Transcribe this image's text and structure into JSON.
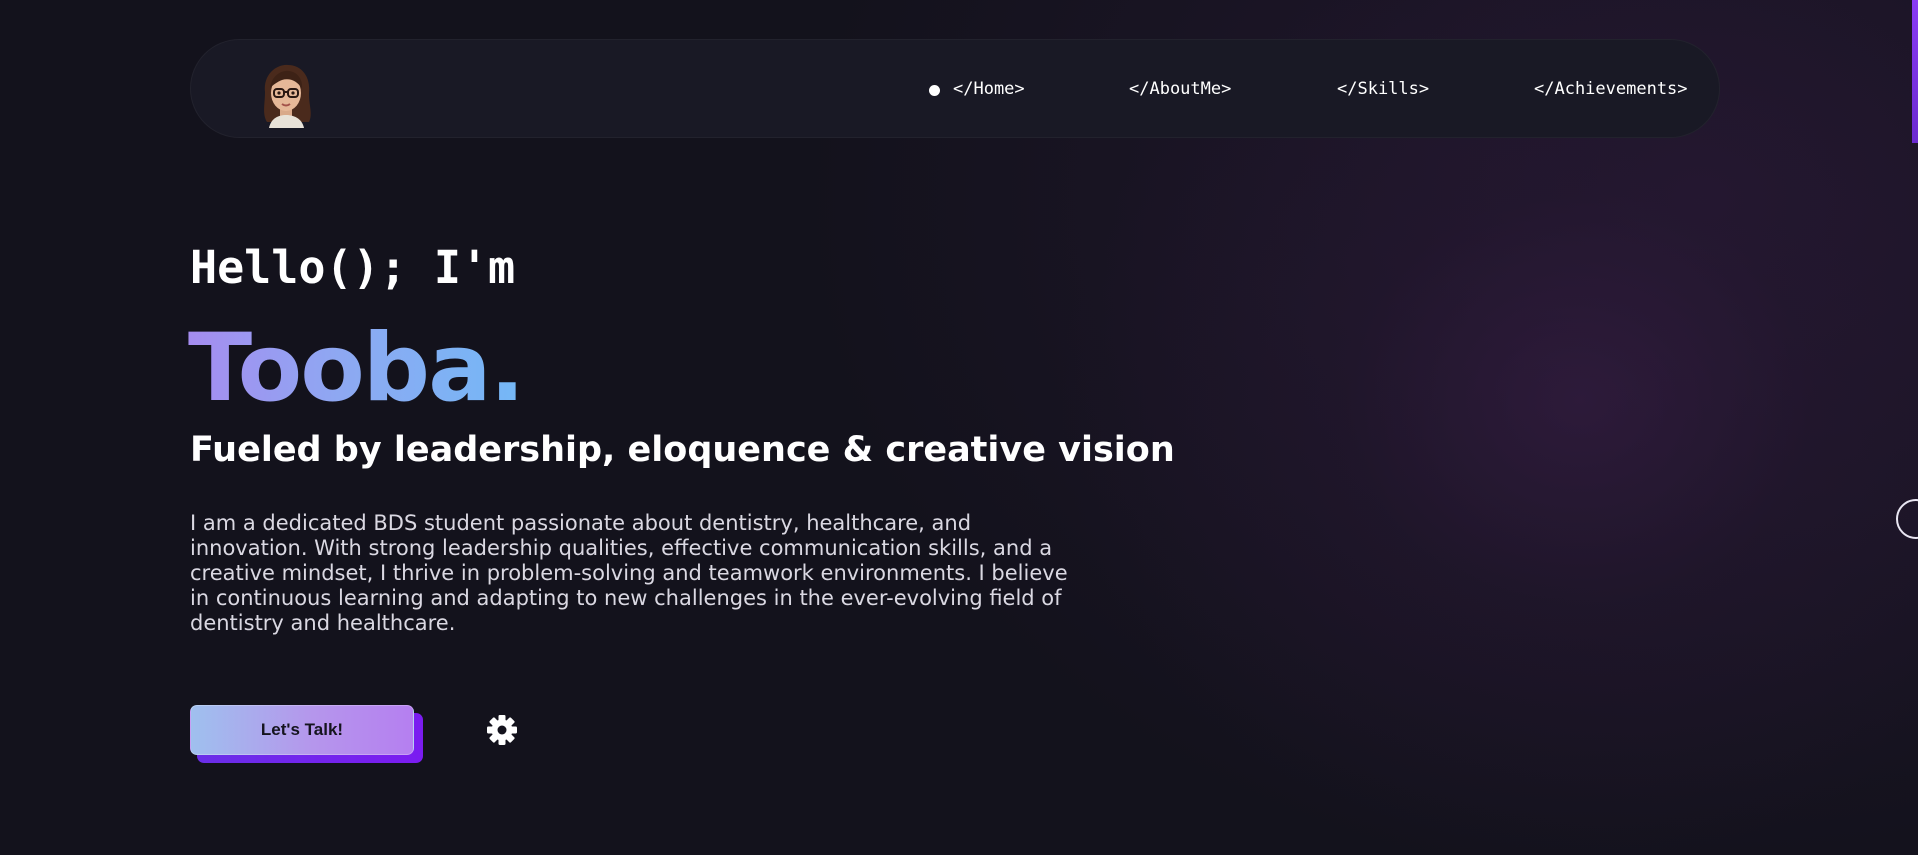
{
  "nav": {
    "avatar_icon": "bitmoji-avatar-icon",
    "links": [
      {
        "label": "</Home>",
        "active": true
      },
      {
        "label": "</AboutMe>"
      },
      {
        "label": "</Skills>"
      },
      {
        "label": "</Achievements>"
      }
    ]
  },
  "hero": {
    "greeting": "Hello(); I'm",
    "name": "Tooba.",
    "tagline": "Fueled by leadership, eloquence & creative vision",
    "bio": "I am a dedicated BDS student passionate about dentistry, healthcare, and innovation. With strong leadership qualities, effective communication skills, and a creative mindset, I thrive in problem-solving and teamwork environments. I believe in continuous learning and adapting to new challenges in the ever-evolving field of dentistry and healthcare.",
    "cta_label": "Let's Talk!",
    "settings_icon": "gear-icon"
  },
  "colors": {
    "background": "#13121c",
    "nav_background": "#191925",
    "name_gradient_start": "#a58cf0",
    "name_gradient_end": "#74b8f6",
    "accent_purple": "#7b1cf0"
  }
}
